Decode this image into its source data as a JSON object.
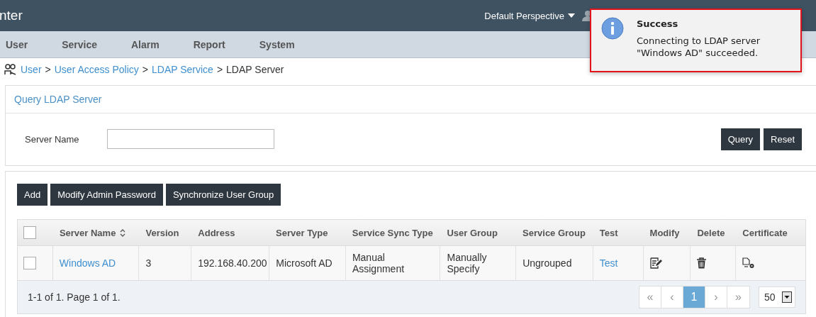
{
  "header": {
    "logo": "nter",
    "perspective": "Default Perspective"
  },
  "nav": [
    {
      "label": "User"
    },
    {
      "label": "Service"
    },
    {
      "label": "Alarm"
    },
    {
      "label": "Report"
    },
    {
      "label": "System"
    }
  ],
  "breadcrumb": [
    {
      "label": "User",
      "kind": "link"
    },
    {
      "label": ">",
      "kind": "separator"
    },
    {
      "label": "User Access Policy",
      "kind": "link"
    },
    {
      "label": ">",
      "kind": "separator"
    },
    {
      "label": "LDAP Service",
      "kind": "link"
    },
    {
      "label": ">",
      "kind": "separator"
    },
    {
      "label": "LDAP Server",
      "kind": "current"
    }
  ],
  "query": {
    "title": "Query LDAP Server",
    "field_label": "Server Name",
    "buttons": [
      "Query",
      "Reset"
    ]
  },
  "toolbar": [
    "Add",
    "Modify Admin Password",
    "Synchronize User Group"
  ],
  "table": {
    "select_all_checked": false,
    "columns": [
      {
        "label": "Server Name",
        "sortable": true
      },
      {
        "label": "Version",
        "sortable": false
      },
      {
        "label": "Address",
        "sortable": false
      },
      {
        "label": "Server Type",
        "sortable": false
      },
      {
        "label": "Service Sync Type",
        "sortable": false
      },
      {
        "label": "User Group",
        "sortable": false
      },
      {
        "label": "Service Group",
        "sortable": false
      },
      {
        "label": "Test",
        "sortable": false
      },
      {
        "label": "Modify",
        "sortable": false
      },
      {
        "label": "Delete",
        "sortable": false
      },
      {
        "label": "Certificate",
        "sortable": false
      }
    ],
    "rows": [
      {
        "checked": false,
        "name": "Windows AD",
        "version": "3",
        "address": "192.168.40.200",
        "server_type": "Microsoft AD",
        "sync_type": "Manual Assignment",
        "user_group": "Manually Specify",
        "service_group": "Ungrouped",
        "test": "Test"
      }
    ]
  },
  "pagination": {
    "summary": "1-1 of 1. Page 1 of 1.",
    "first": "«",
    "prev": "‹",
    "pages": [
      {
        "label": "1",
        "selected": true
      }
    ],
    "next": "›",
    "last": "»",
    "page_size": "50"
  },
  "toast": {
    "title": "Success",
    "message": "Connecting to LDAP server \"Windows AD\" succeeded."
  }
}
